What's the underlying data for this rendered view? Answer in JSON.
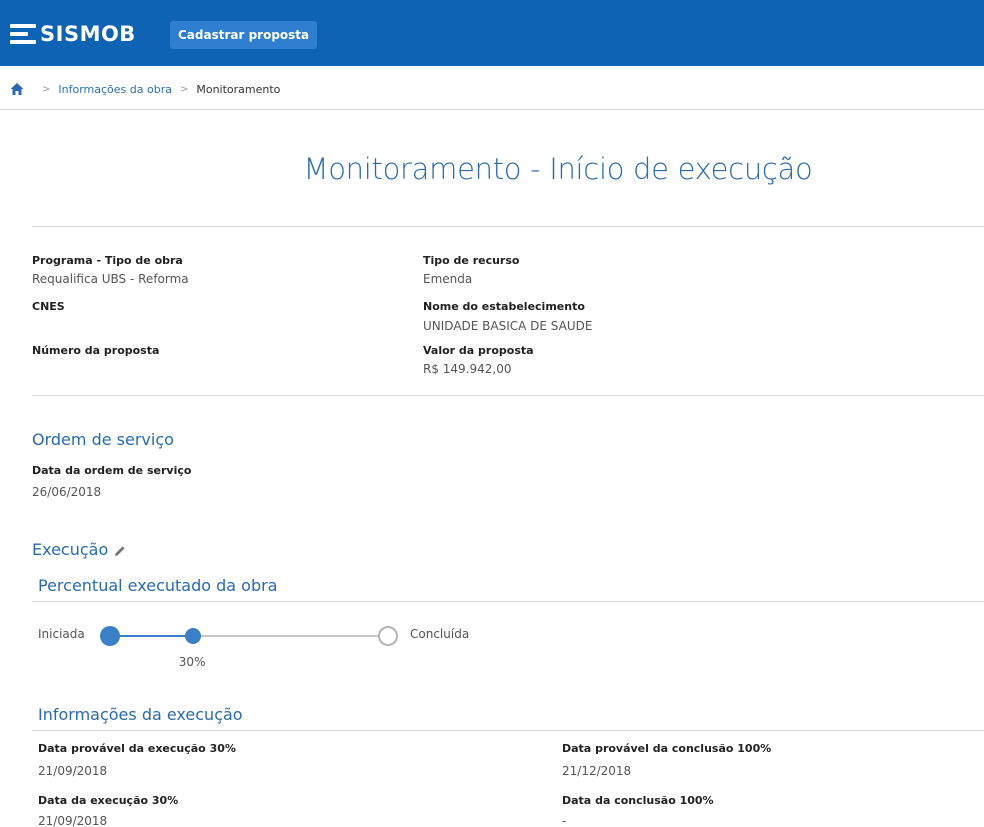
{
  "header": {
    "app_name": "SISMOB",
    "cadastrar_label": "Cadastrar proposta",
    "brand_color": "#0f63b5"
  },
  "breadcrumb": {
    "home_icon": "home-icon",
    "items": [
      "Informações da obra",
      "Monitoramento"
    ]
  },
  "page": {
    "title": "Monitoramento - Início de execução"
  },
  "info": {
    "programa_label": "Programa - Tipo de obra",
    "programa_value": "Requalifica UBS - Reforma",
    "tipo_recurso_label": "Tipo de recurso",
    "tipo_recurso_value": "Emenda",
    "cnes_label": "CNES",
    "nome_label": "Nome do estabelecimento",
    "nome_value": "UNIDADE BASICA DE SAUDE",
    "numero_label": "Número da proposta",
    "valor_label": "Valor da proposta",
    "valor_value": "R$ 149.942,00"
  },
  "ordem": {
    "title": "Ordem de serviço",
    "data_label": "Data da ordem de serviço",
    "data_value": "26/06/2018"
  },
  "execucao": {
    "title": "Execução",
    "edit_icon": "pencil-icon",
    "percentual_title": "Percentual executado da obra",
    "start_label": "Iniciada",
    "end_label": "Concluída",
    "current_label": "30%",
    "progress_fraction": 0.3,
    "accent_color": "#3a80c6"
  },
  "info_execucao": {
    "title": "Informações da execução",
    "prov_exec_label": "Data provável da execução 30%",
    "prov_exec_value": "21/09/2018",
    "prov_concl_label": "Data provável da conclusão 100%",
    "prov_concl_value": "21/12/2018",
    "exec_label": "Data da execução 30%",
    "exec_value": "21/09/2018",
    "concl_label": "Data da conclusão 100%",
    "concl_value": "-"
  }
}
